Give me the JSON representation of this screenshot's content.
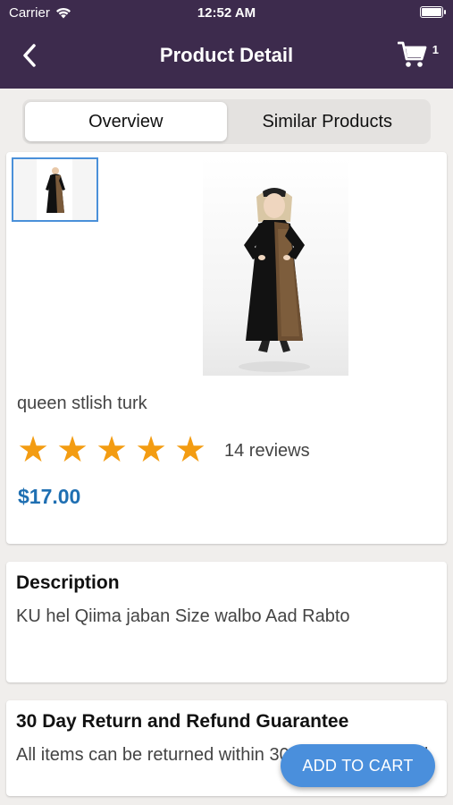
{
  "status_bar": {
    "carrier": "Carrier",
    "time": "12:52 AM"
  },
  "nav": {
    "title": "Product Detail",
    "cart_count": "1"
  },
  "tabs": [
    {
      "label": "Overview",
      "active": true
    },
    {
      "label": "Similar Products",
      "active": false
    }
  ],
  "product": {
    "name": "queen stlish turk",
    "rating": 5,
    "stars": [
      "★",
      "★",
      "★",
      "★",
      "★"
    ],
    "reviews": "14 reviews",
    "price": "$17.00"
  },
  "description": {
    "heading": "Description",
    "text": "KU hel Qiima jaban  Size walbo Aad Rabto"
  },
  "guarantee": {
    "heading": "30 Day Return and Refund Guarantee",
    "text": "All items can be returned within 30 days for a refund"
  },
  "add_to_cart": "ADD TO CART",
  "colors": {
    "nav_bg": "#3d2b4d",
    "accent": "#4a8fdc",
    "price": "#1f6fb2",
    "star": "#f39c12"
  }
}
